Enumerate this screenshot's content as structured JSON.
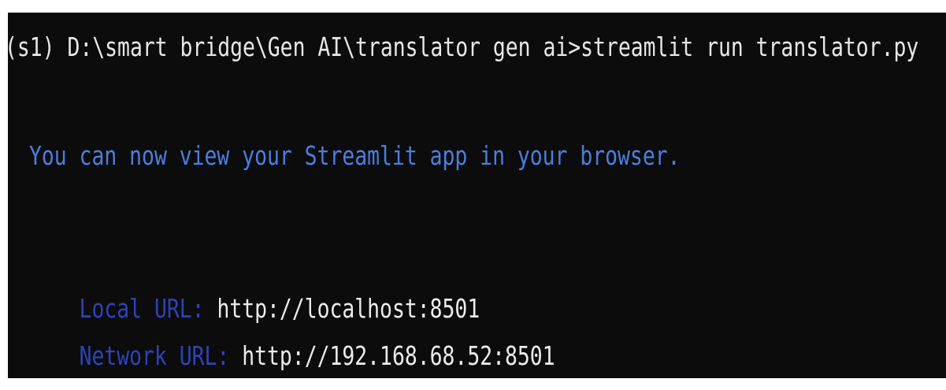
{
  "terminal": {
    "command_line": "(s1) D:\\smart bridge\\Gen AI\\translator gen ai>streamlit run translator.py",
    "info_message": "You can now view your Streamlit app in your browser.",
    "local": {
      "label": "Local URL:",
      "url": "http://localhost:8501"
    },
    "network": {
      "label": "Network URL:",
      "url": "http://192.168.68.52:8501"
    }
  },
  "colors": {
    "background": "#0c0c0c",
    "command_text": "#e8e8e8",
    "info_text": "#4a7fe0",
    "url_label": "#2c43b8",
    "url_value": "#ececec"
  }
}
